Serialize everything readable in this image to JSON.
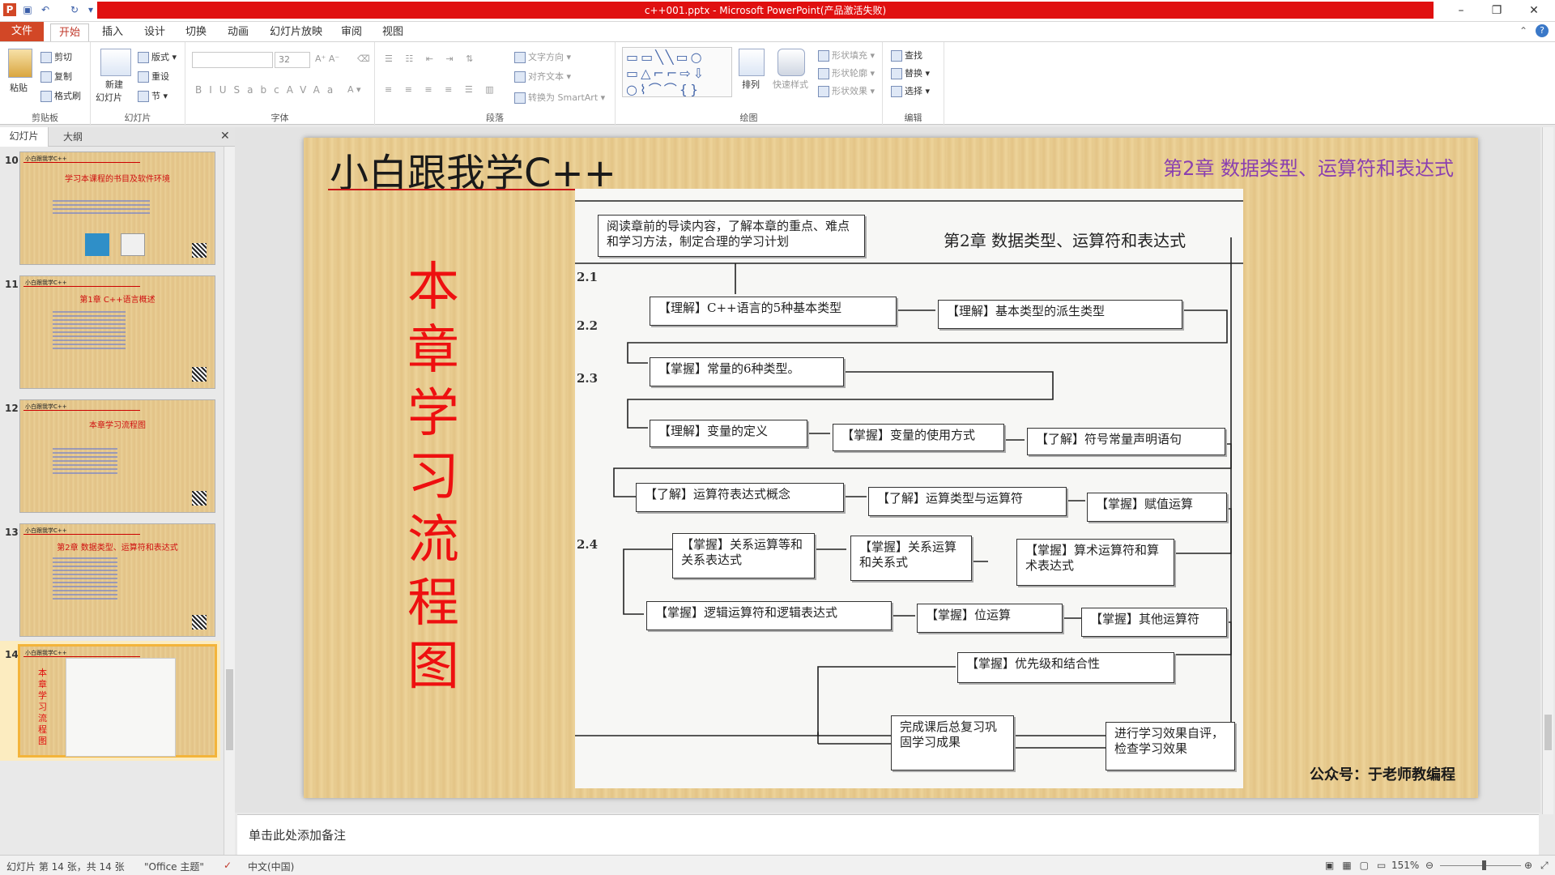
{
  "window": {
    "title": "c++001.pptx - Microsoft PowerPoint(产品激活失败)",
    "minimize": "–",
    "restore": "❐",
    "close": "✕"
  },
  "tabs": [
    "文件",
    "开始",
    "插入",
    "设计",
    "切换",
    "动画",
    "幻灯片放映",
    "审阅",
    "视图"
  ],
  "ribbon": {
    "clipboard": {
      "paste": "粘贴",
      "cut": "剪切",
      "copy": "复制",
      "format_painter": "格式刷",
      "label": "剪贴板"
    },
    "slides": {
      "new": "新建",
      "new2": "幻灯片",
      "layout": "版式",
      "reset": "重设",
      "section": "节",
      "label": "幻灯片"
    },
    "font": {
      "size": "32",
      "label": "字体"
    },
    "paragraph": {
      "text_direction": "文字方向",
      "align_text": "对齐文本",
      "smartart": "转换为 SmartArt",
      "label": "段落"
    },
    "drawing": {
      "arrange": "排列",
      "quick_styles": "快速样式",
      "fill": "形状填充",
      "outline": "形状轮廓",
      "effects": "形状效果",
      "label": "绘图"
    },
    "editing": {
      "find": "查找",
      "replace": "替换",
      "select": "选择",
      "label": "编辑"
    }
  },
  "pane": {
    "tab_slides": "幻灯片",
    "tab_outline": "大纲"
  },
  "thumbnails": [
    {
      "num": "10",
      "top": "小白跟我学C++",
      "title": "学习本课程的书目及软件环境"
    },
    {
      "num": "11",
      "top": "小白跟我学C++",
      "title": "第1章 C++语言概述"
    },
    {
      "num": "12",
      "top": "小白跟我学C++",
      "title": "本章学习流程图"
    },
    {
      "num": "13",
      "top": "小白跟我学C++",
      "title": "第2章 数据类型、运算符和表达式"
    },
    {
      "num": "14",
      "top": "小白跟我学C++",
      "title": ""
    }
  ],
  "slide": {
    "heading": "小白跟我学C++",
    "chapter": "第2章 数据类型、运算符和表达式",
    "vertical_title": "本章学习流程图",
    "footer": "公众号：于老师教编程",
    "scan": {
      "intro": "阅读章前的导读内容，了解本章的重点、难点和学习方法，制定合理的学习计划",
      "chapter": "第2章 数据类型、运算符和表达式",
      "sections": [
        "2.1",
        "2.2",
        "2.3",
        "2.4"
      ],
      "boxes": [
        "【理解】C++语言的5种基本类型",
        "【理解】基本类型的派生类型",
        "【掌握】常量的6种类型。",
        "【理解】变量的定义",
        "【掌握】变量的使用方式",
        "【了解】符号常量声明语句",
        "【了解】运算符表达式概念",
        "【了解】运算类型与运算符",
        "【掌握】赋值运算",
        "【掌握】关系运算等和关系表达式",
        "【掌握】关系运算和关系式",
        "【掌握】算术运算符和算术表达式",
        "【掌握】逻辑运算符和逻辑表达式",
        "【掌握】位运算",
        "【掌握】其他运算符",
        "【掌握】优先级和结合性",
        "完成课后总复习巩固学习成果",
        "进行学习效果自评，检查学习效果"
      ]
    }
  },
  "notes_placeholder": "单击此处添加备注",
  "status": {
    "slide_info": "幻灯片 第 14 张，共 14 张",
    "theme": "\"Office 主题\"",
    "language": "中文(中国)",
    "zoom": "151%"
  }
}
